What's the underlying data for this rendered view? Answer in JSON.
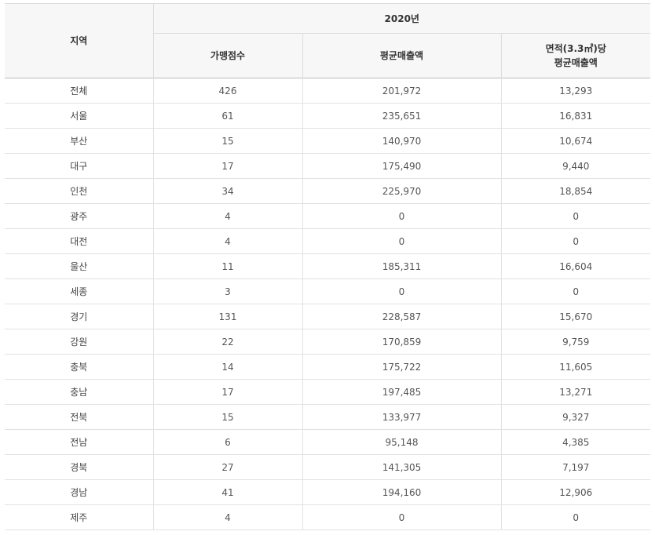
{
  "header": {
    "region": "지역",
    "year": "2020년",
    "count": "가맹점수",
    "avg_sales": "평균매출액",
    "area_line1": "면적(3.3㎡)당",
    "area_line2": "평균매출액"
  },
  "rows": [
    {
      "region": "전체",
      "count": "426",
      "avg_sales": "201,972",
      "area_sales": "13,293"
    },
    {
      "region": "서울",
      "count": "61",
      "avg_sales": "235,651",
      "area_sales": "16,831"
    },
    {
      "region": "부산",
      "count": "15",
      "avg_sales": "140,970",
      "area_sales": "10,674"
    },
    {
      "region": "대구",
      "count": "17",
      "avg_sales": "175,490",
      "area_sales": "9,440"
    },
    {
      "region": "인천",
      "count": "34",
      "avg_sales": "225,970",
      "area_sales": "18,854"
    },
    {
      "region": "광주",
      "count": "4",
      "avg_sales": "0",
      "area_sales": "0"
    },
    {
      "region": "대전",
      "count": "4",
      "avg_sales": "0",
      "area_sales": "0"
    },
    {
      "region": "울산",
      "count": "11",
      "avg_sales": "185,311",
      "area_sales": "16,604"
    },
    {
      "region": "세종",
      "count": "3",
      "avg_sales": "0",
      "area_sales": "0"
    },
    {
      "region": "경기",
      "count": "131",
      "avg_sales": "228,587",
      "area_sales": "15,670"
    },
    {
      "region": "강원",
      "count": "22",
      "avg_sales": "170,859",
      "area_sales": "9,759"
    },
    {
      "region": "충북",
      "count": "14",
      "avg_sales": "175,722",
      "area_sales": "11,605"
    },
    {
      "region": "충남",
      "count": "17",
      "avg_sales": "197,485",
      "area_sales": "13,271"
    },
    {
      "region": "전북",
      "count": "15",
      "avg_sales": "133,977",
      "area_sales": "9,327"
    },
    {
      "region": "전남",
      "count": "6",
      "avg_sales": "95,148",
      "area_sales": "4,385"
    },
    {
      "region": "경북",
      "count": "27",
      "avg_sales": "141,305",
      "area_sales": "7,197"
    },
    {
      "region": "경남",
      "count": "41",
      "avg_sales": "194,160",
      "area_sales": "12,906"
    },
    {
      "region": "제주",
      "count": "4",
      "avg_sales": "0",
      "area_sales": "0"
    }
  ]
}
